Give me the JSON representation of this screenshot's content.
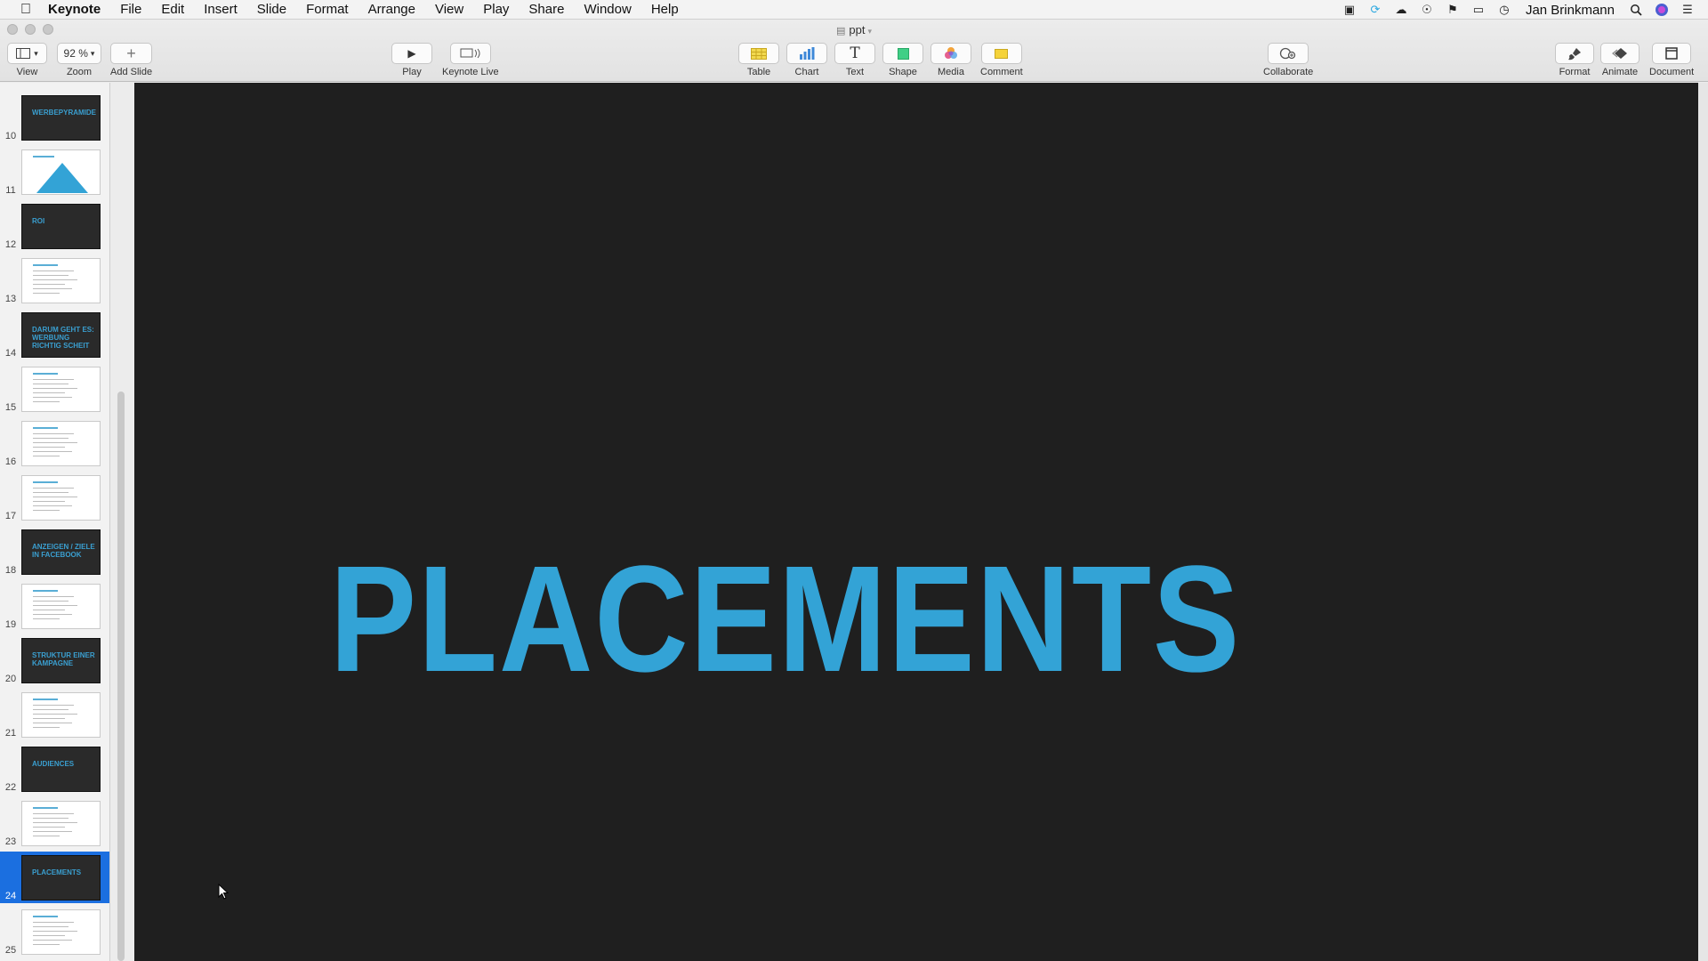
{
  "menubar": {
    "app": "Keynote",
    "items": [
      "File",
      "Edit",
      "Insert",
      "Slide",
      "Format",
      "Arrange",
      "View",
      "Play",
      "Share",
      "Window",
      "Help"
    ],
    "user": "Jan Brinkmann",
    "status_icons": [
      "screen-record-icon",
      "sync-icon",
      "cloud-icon",
      "password-icon",
      "notification-icon",
      "airplay-icon",
      "time-machine-icon"
    ]
  },
  "window": {
    "title": "ppt"
  },
  "toolbar": {
    "view_label": "View",
    "zoom_value": "92 %",
    "zoom_label": "Zoom",
    "add_slide_label": "Add Slide",
    "play_label": "Play",
    "keynote_live_label": "Keynote Live",
    "table_label": "Table",
    "chart_label": "Chart",
    "text_label": "Text",
    "shape_label": "Shape",
    "media_label": "Media",
    "comment_label": "Comment",
    "collaborate_label": "Collaborate",
    "format_label": "Format",
    "animate_label": "Animate",
    "document_label": "Document",
    "colors": {
      "table": "#f2d94e",
      "chart": "#3f89d8",
      "shape": "#3fcf86",
      "comment": "#f5d33a"
    }
  },
  "navigator": {
    "selected": "24",
    "slides": [
      {
        "num": "10",
        "kind": "dark",
        "title": "WERBEPYRAMIDE"
      },
      {
        "num": "11",
        "kind": "triangle",
        "title": ""
      },
      {
        "num": "12",
        "kind": "dark",
        "title": "ROI"
      },
      {
        "num": "13",
        "kind": "light",
        "title": ""
      },
      {
        "num": "14",
        "kind": "dark",
        "title": "DARUM GEHT ES: WERBUNG RICHTIG SCHEIT"
      },
      {
        "num": "15",
        "kind": "light",
        "title": ""
      },
      {
        "num": "16",
        "kind": "light",
        "title": ""
      },
      {
        "num": "17",
        "kind": "light",
        "title": ""
      },
      {
        "num": "18",
        "kind": "dark",
        "title": "ANZEIGEN / ZIELE IN FACEBOOK"
      },
      {
        "num": "19",
        "kind": "light",
        "title": ""
      },
      {
        "num": "20",
        "kind": "dark",
        "title": "STRUKTUR EINER KAMPAGNE"
      },
      {
        "num": "21",
        "kind": "light",
        "title": ""
      },
      {
        "num": "22",
        "kind": "dark",
        "title": "AUDIENCES"
      },
      {
        "num": "23",
        "kind": "light",
        "title": ""
      },
      {
        "num": "24",
        "kind": "dark",
        "title": "PLACEMENTS"
      },
      {
        "num": "25",
        "kind": "light",
        "title": ""
      }
    ]
  },
  "slide": {
    "title": "PLACEMENTS",
    "title_color": "#33a3d6",
    "background": "#1f1f1f"
  }
}
